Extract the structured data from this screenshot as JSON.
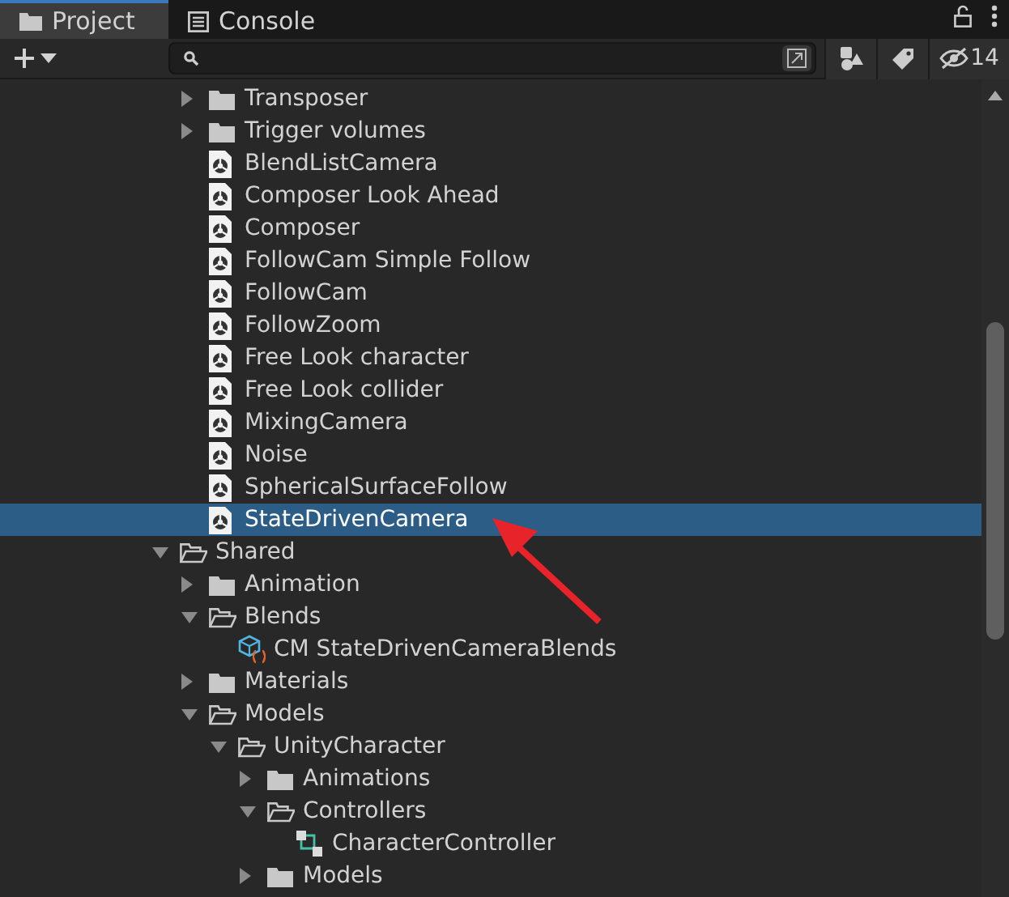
{
  "tabs": [
    {
      "label": "Project",
      "kind": "project",
      "selected": true
    },
    {
      "label": "Console",
      "kind": "console",
      "selected": false
    }
  ],
  "toolbar": {
    "hidden_count": "14"
  },
  "tree": [
    {
      "children": [
        {
          "label": "Transposer",
          "kind": "folder",
          "expanded": false,
          "selected": false
        },
        {
          "label": "Trigger volumes",
          "kind": "folder",
          "expanded": false,
          "selected": false
        },
        {
          "label": "BlendListCamera",
          "kind": "camera",
          "selected": false
        },
        {
          "label": "Composer Look Ahead",
          "kind": "camera",
          "selected": false
        },
        {
          "label": "Composer",
          "kind": "camera",
          "selected": false
        },
        {
          "label": "FollowCam Simple Follow",
          "kind": "camera",
          "selected": false
        },
        {
          "label": "FollowCam",
          "kind": "camera",
          "selected": false
        },
        {
          "label": "FollowZoom",
          "kind": "camera",
          "selected": false
        },
        {
          "label": "Free Look character",
          "kind": "camera",
          "selected": false
        },
        {
          "label": "Free Look collider",
          "kind": "camera",
          "selected": false
        },
        {
          "label": "MixingCamera",
          "kind": "camera",
          "selected": false
        },
        {
          "label": "Noise",
          "kind": "camera",
          "selected": false
        },
        {
          "label": "SphericalSurfaceFollow",
          "kind": "camera",
          "selected": false
        },
        {
          "label": "StateDrivenCamera",
          "kind": "camera",
          "selected": true
        }
      ]
    },
    {
      "label": "Shared",
      "kind": "folder",
      "expanded": true,
      "selected": false,
      "children": [
        {
          "label": "Animation",
          "kind": "folder",
          "expanded": false,
          "selected": false
        },
        {
          "label": "Blends",
          "kind": "folder",
          "expanded": true,
          "selected": false,
          "children": [
            {
              "label": "CM StateDrivenCameraBlends",
              "kind": "blend",
              "selected": false
            }
          ]
        },
        {
          "label": "Materials",
          "kind": "folder",
          "expanded": false,
          "selected": false
        },
        {
          "label": "Models",
          "kind": "folder",
          "expanded": true,
          "selected": false,
          "children": [
            {
              "label": "UnityCharacter",
              "kind": "folder",
              "expanded": true,
              "selected": false,
              "children": [
                {
                  "label": "Animations",
                  "kind": "folder",
                  "expanded": false,
                  "selected": false
                },
                {
                  "label": "Controllers",
                  "kind": "folder",
                  "expanded": true,
                  "selected": false,
                  "children": [
                    {
                      "label": "CharacterController",
                      "kind": "controller",
                      "selected": false
                    }
                  ]
                },
                {
                  "label": "Models",
                  "kind": "folder",
                  "expanded": false,
                  "selected": false
                }
              ]
            }
          ]
        }
      ]
    }
  ]
}
